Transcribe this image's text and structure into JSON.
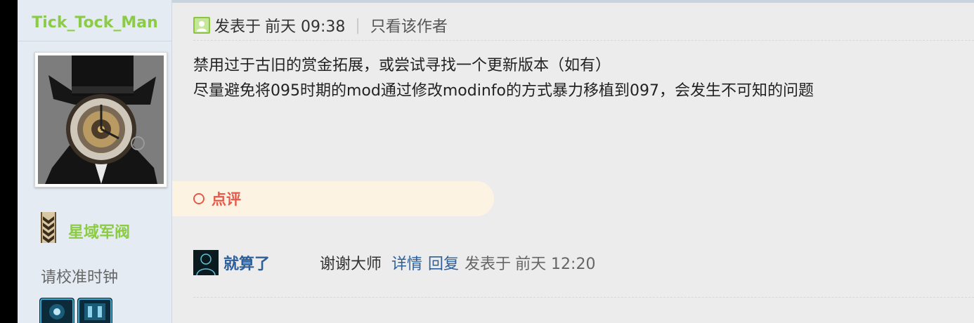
{
  "user": {
    "username": "Tick_Tock_Man",
    "rank_title": "星域军阀",
    "status_text": "请校准时钟"
  },
  "post": {
    "posted_label": "发表于",
    "posted_time": "前天 09:38",
    "separator": "|",
    "author_only_link": "只看该作者",
    "body_lines": [
      "禁用过于古旧的赏金拓展，或尝试寻找一个更新版本（如有）",
      "尽量避免将095时期的mod通过修改modinfo的方式暴力移植到097，会发生不可知的问题"
    ]
  },
  "comments": {
    "section_label": "点评",
    "items": [
      {
        "user": "就算了",
        "text": "谢谢大师",
        "details_link": "详情",
        "reply_link": "回复",
        "posted_label": "发表于",
        "posted_time": "前天 12:20"
      }
    ]
  },
  "colors": {
    "username_green": "#8ccc44",
    "link_blue": "#2d5f9a",
    "comment_red": "#e4594a",
    "comment_bg": "#fdf3e3",
    "sidebar_bg": "#e4ebf2"
  }
}
